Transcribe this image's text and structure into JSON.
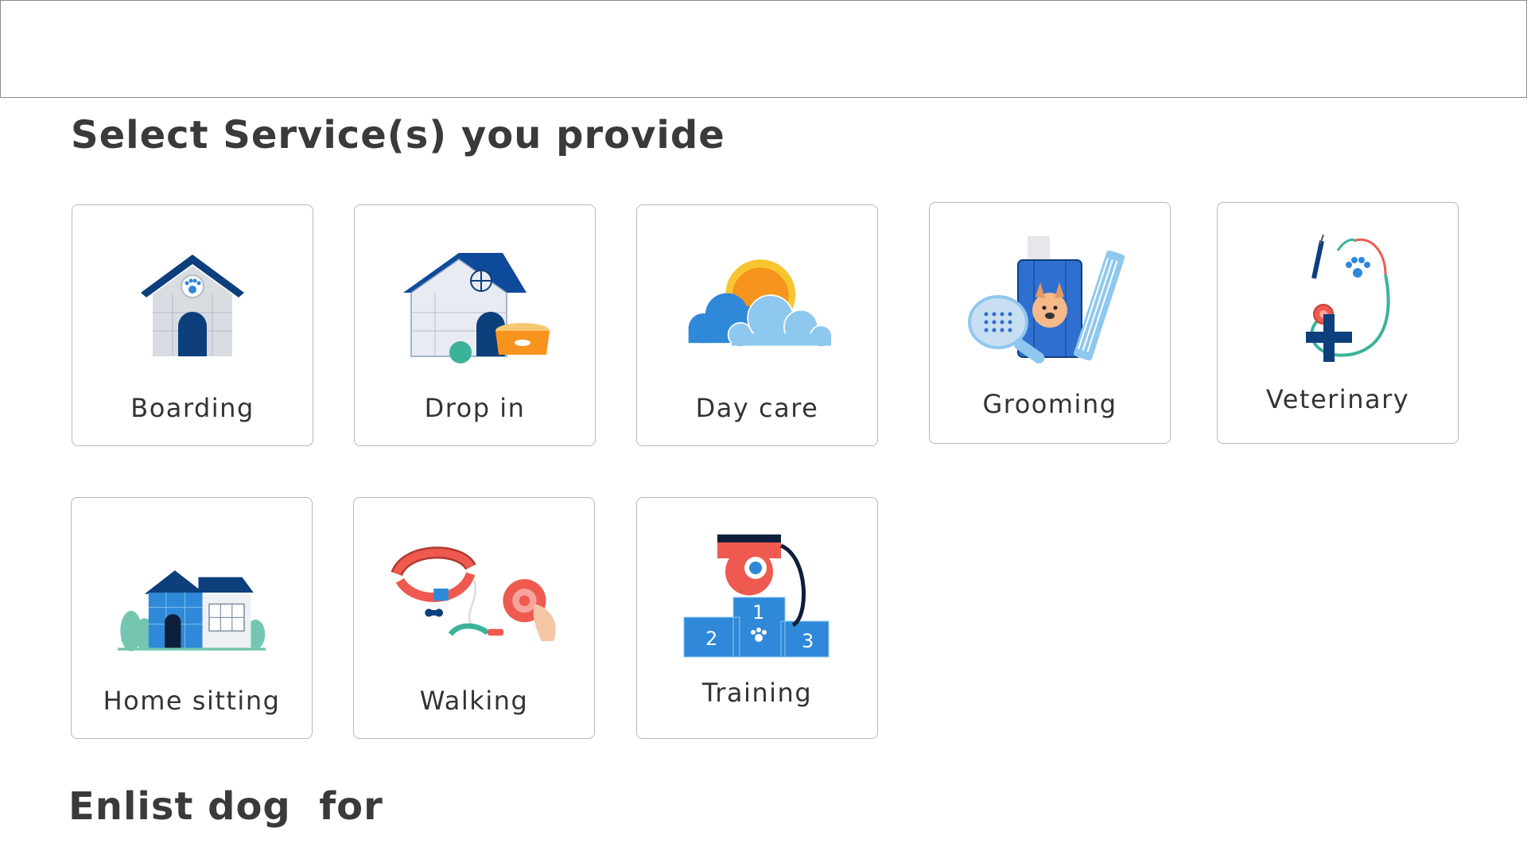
{
  "header": {},
  "services_section": {
    "title": "Select Service(s) you provide",
    "services": [
      {
        "id": "boarding",
        "label": "Boarding",
        "icon": "dog-house-icon"
      },
      {
        "id": "drop-in",
        "label": "Drop in",
        "icon": "dog-house-with-food-bowl-icon"
      },
      {
        "id": "day-care",
        "label": "Day care",
        "icon": "sun-and-clouds-icon"
      },
      {
        "id": "grooming",
        "label": "Grooming",
        "icon": "grooming-tools-icon"
      },
      {
        "id": "veterinary",
        "label": "Veterinary",
        "icon": "stethoscope-syringe-icon"
      },
      {
        "id": "home-sitting",
        "label": "Home sitting",
        "icon": "house-icon"
      },
      {
        "id": "walking",
        "label": "Walking",
        "icon": "collar-and-leash-icon"
      },
      {
        "id": "training",
        "label": "Training",
        "icon": "whistle-podium-icon"
      }
    ]
  },
  "enlist_section": {
    "title": "Enlist dog  for"
  },
  "colors": {
    "navy": "#0d3f7c",
    "blue": "#2f88d8",
    "light_blue": "#8fc8ee",
    "orange": "#f7941d",
    "coral": "#ee5a4f",
    "teal": "#3bb39a",
    "border": "#b8b8b8"
  }
}
